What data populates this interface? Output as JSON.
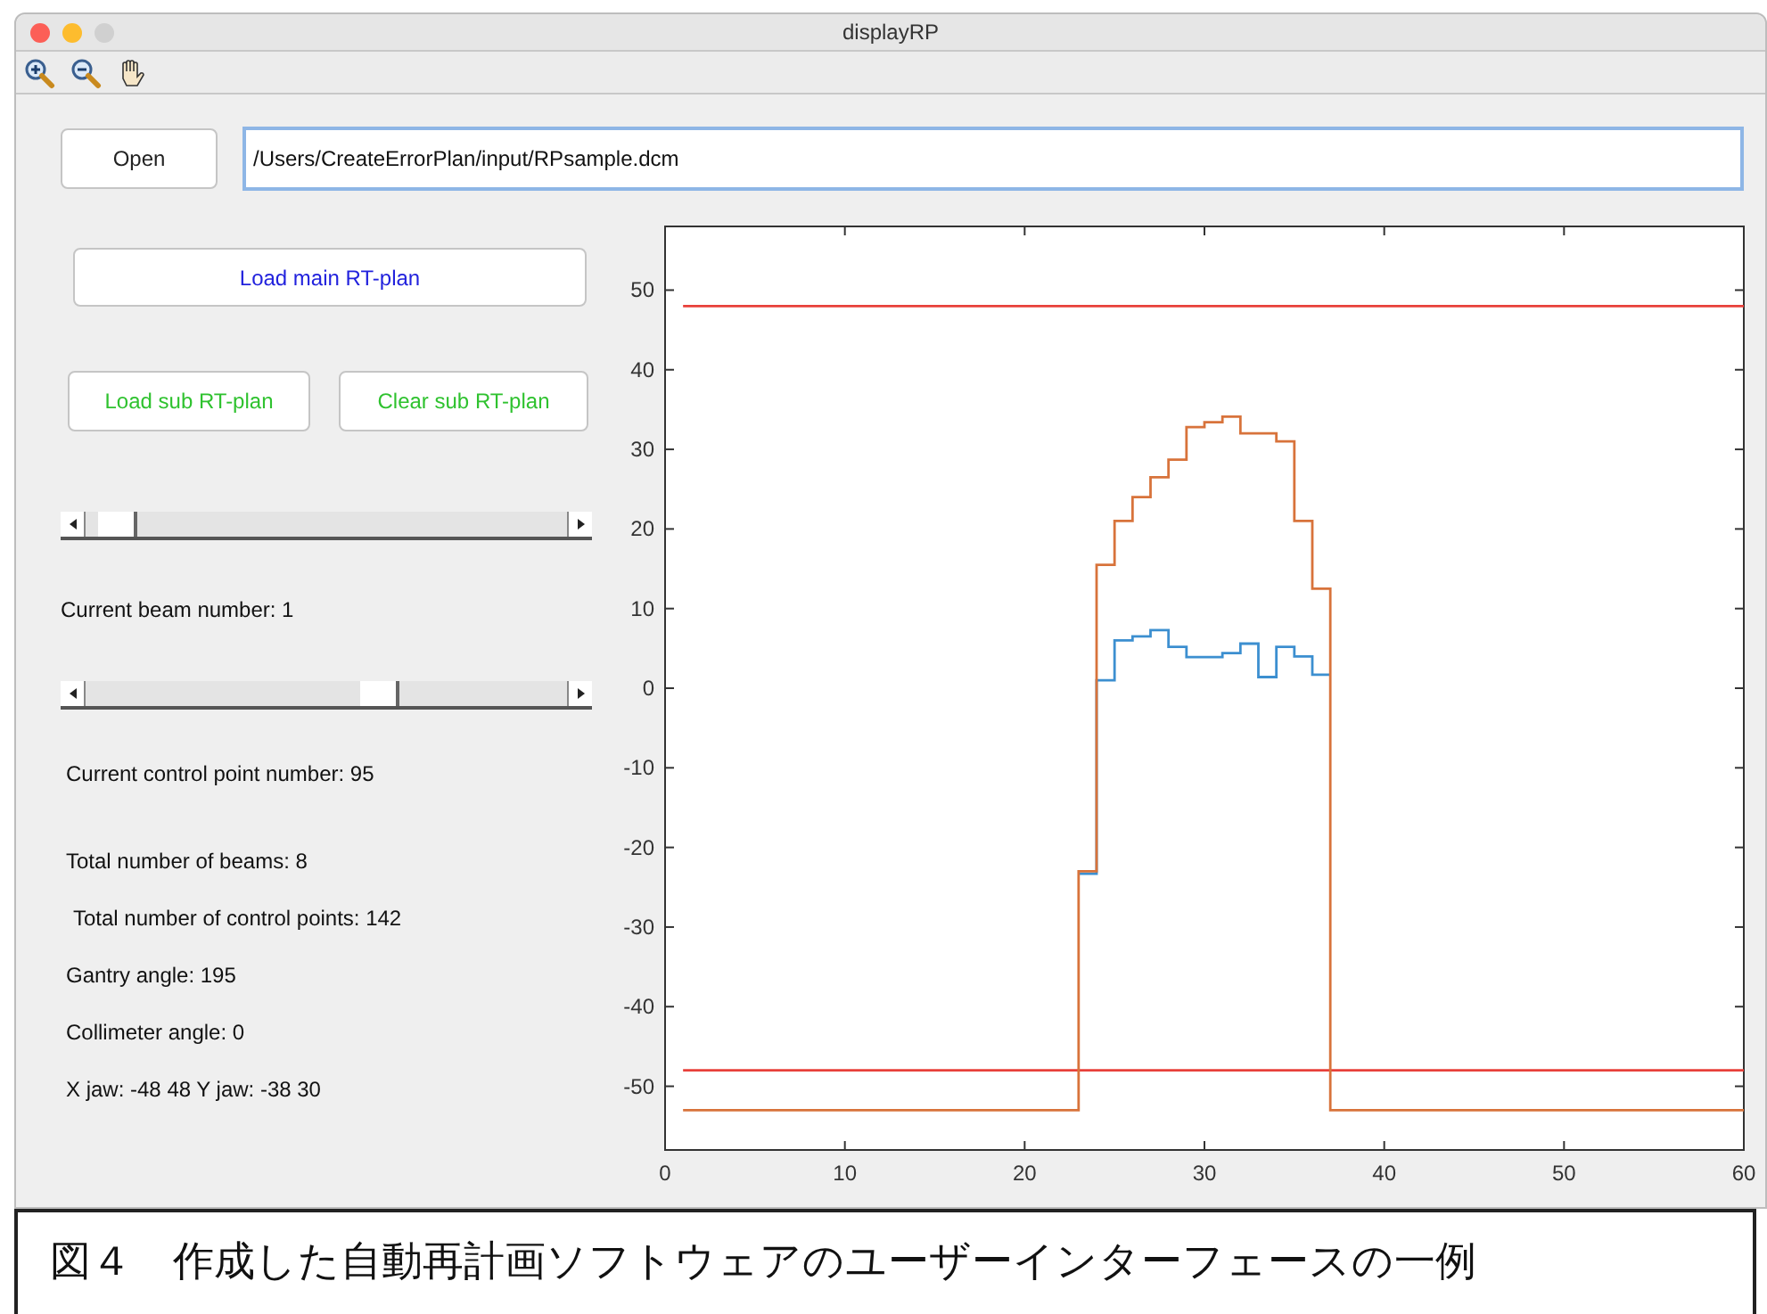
{
  "window": {
    "title": "displayRP"
  },
  "toolbar": [
    {
      "kind": "zoom-in"
    },
    {
      "kind": "zoom-out"
    },
    {
      "kind": "pan"
    }
  ],
  "open_button": "Open",
  "file_path": {
    "value": "/Users/CreateErrorPlan/input/RPsample.dcm"
  },
  "load_main_button": "Load main RT-plan",
  "load_sub_button": "Load sub RT-plan",
  "clear_sub_button": "Clear sub RT-plan",
  "beam_slider": {
    "level": 0.03
  },
  "beam_label": "Current beam number: 1",
  "control_point_slider": {
    "level": 0.62
  },
  "control_point_label": "Current control point number: 95",
  "info": [
    "Total number of beams: 8",
    "Total number of control points: 142",
    "Gantry angle: 195",
    "Collimeter angle: 0",
    "X jaw: -48 48  Y jaw: -38 30"
  ],
  "chart_data": {
    "type": "line",
    "xlim": [
      0,
      60
    ],
    "ylim": [
      -58,
      58
    ],
    "xticks": [
      0,
      10,
      20,
      30,
      40,
      50,
      60
    ],
    "yticks": [
      -50,
      -40,
      -30,
      -20,
      -10,
      0,
      10,
      20,
      30,
      40,
      50
    ],
    "x": [
      1,
      23,
      23,
      24,
      24,
      25,
      25,
      26,
      26,
      27,
      27,
      28,
      28,
      29,
      29,
      30,
      30,
      31,
      31,
      32,
      32,
      33,
      33,
      34,
      34,
      35,
      35,
      36,
      36,
      37,
      37,
      60
    ],
    "series": [
      {
        "color": "#e8403a",
        "values": [
          48,
          48,
          48,
          48,
          48,
          48,
          48,
          48,
          48,
          48,
          48,
          48,
          48,
          48,
          48,
          48,
          48,
          48,
          48,
          48,
          48,
          48,
          48,
          48,
          48,
          48,
          48,
          48,
          48,
          48,
          48,
          48
        ]
      },
      {
        "color": "#e8403a",
        "values": [
          -48,
          -48,
          -48,
          -48,
          -48,
          -48,
          -48,
          -48,
          -48,
          -48,
          -48,
          -48,
          -48,
          -48,
          -48,
          -48,
          -48,
          -48,
          -48,
          -48,
          -48,
          -48,
          -48,
          -48,
          -48,
          -48,
          -48,
          -48,
          -48,
          -48,
          -48,
          -48
        ]
      },
      {
        "color": "#3c8fd0",
        "values": [
          null,
          null,
          -23.3,
          -23.3,
          1,
          1,
          6,
          6,
          6.5,
          6.5,
          7.3,
          7.3,
          5.2,
          5.2,
          3.9,
          3.9,
          3.9,
          3.9,
          4.4,
          4.4,
          5.6,
          5.6,
          1.4,
          1.4,
          5.2,
          5.2,
          4,
          4,
          1.7,
          1.7,
          null,
          null
        ]
      },
      {
        "color": "#d8733b",
        "values": [
          -53,
          -53,
          -23,
          -23,
          15.5,
          15.5,
          21,
          21,
          24,
          24,
          26.5,
          26.5,
          28.7,
          28.7,
          32.8,
          32.8,
          33.4,
          33.4,
          34.1,
          34.1,
          32,
          32,
          32,
          32,
          31,
          31,
          21,
          21,
          12.5,
          12.5,
          -53,
          -53
        ]
      }
    ]
  },
  "caption": "図４　作成した自動再計画ソフトウェアのユーザーインターフェースの一例"
}
